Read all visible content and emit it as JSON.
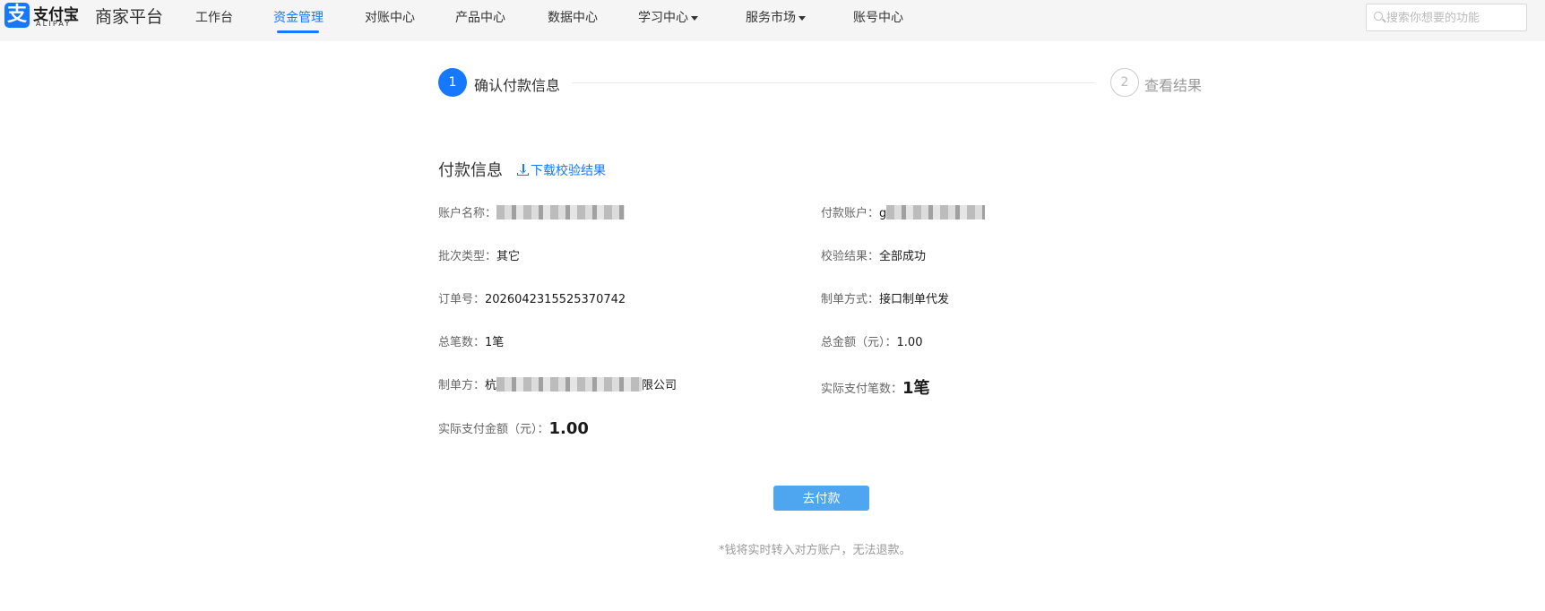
{
  "brand": {
    "logo_glyph": "支",
    "name": "支付宝",
    "sub": "ALIPAY",
    "platform": "商家平台",
    "color": "#1677ff"
  },
  "nav": {
    "items": [
      {
        "label": "工作台"
      },
      {
        "label": "资金管理",
        "active": true
      },
      {
        "label": "对账中心"
      },
      {
        "label": "产品中心"
      },
      {
        "label": "数据中心"
      },
      {
        "label": "学习中心",
        "dropdown": true
      },
      {
        "label": "服务市场",
        "dropdown": true
      },
      {
        "label": "账号中心"
      }
    ]
  },
  "search": {
    "placeholder": "搜索你想要的功能",
    "icon": "search-icon"
  },
  "steps": [
    {
      "number": "1",
      "label": "确认付款信息",
      "status": "active"
    },
    {
      "number": "2",
      "label": "查看结果",
      "status": "pending"
    }
  ],
  "section": {
    "title": "付款信息",
    "download_label": "下载校验结果"
  },
  "fields": {
    "account_name": {
      "label": "账户名称：",
      "value": ""
    },
    "pay_account": {
      "label": "付款账户：",
      "value_prefix": "g"
    },
    "batch_type": {
      "label": "批次类型：",
      "value": "其它"
    },
    "verify_result": {
      "label": "校验结果：",
      "value": "全部成功"
    },
    "order_no": {
      "label": "订单号：",
      "value": "2026042315525370742"
    },
    "create_method": {
      "label": "制单方式：",
      "value": "接口制单代发"
    },
    "total_count": {
      "label": "总笔数：",
      "value": "1笔"
    },
    "total_amount": {
      "label": "总金额（元）：",
      "value": "1.00"
    },
    "creator": {
      "label": "制单方：",
      "value_prefix": "杭",
      "value_suffix": "限公司"
    },
    "actual_count": {
      "label": "实际支付笔数：",
      "value": "1笔"
    },
    "actual_amount": {
      "label": "实际支付金额（元）：",
      "value": "1.00"
    }
  },
  "action": {
    "pay_label": "去付款",
    "note": "*钱将实时转入对方账户，无法退款。"
  }
}
